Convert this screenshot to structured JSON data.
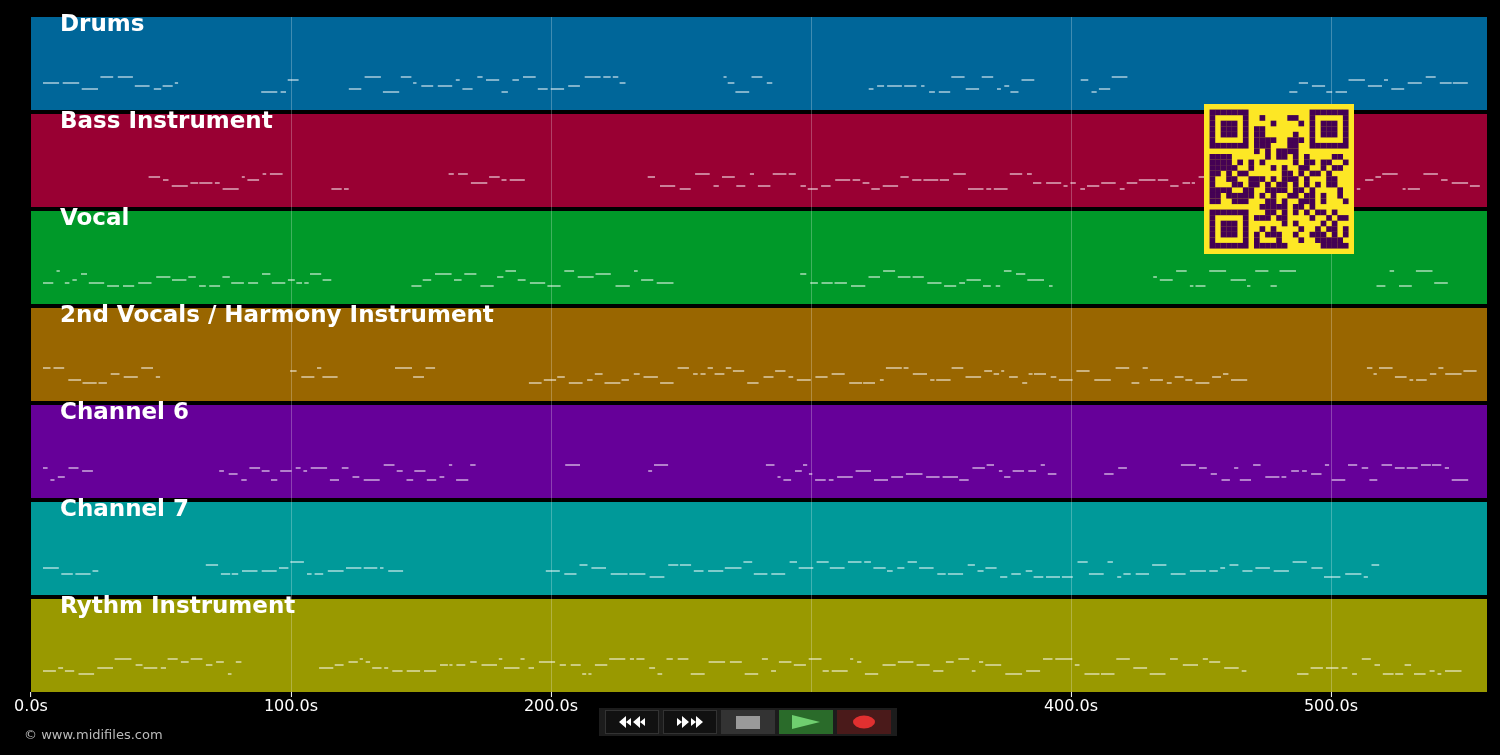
{
  "tracks": [
    {
      "name": "Drums",
      "color": "#006699"
    },
    {
      "name": "Bass Instrument",
      "color": "#990033"
    },
    {
      "name": "Vocal",
      "color": "#009929"
    },
    {
      "name": "2nd Vocals / Harmony Instrument",
      "color": "#996600"
    },
    {
      "name": "Channel 6",
      "color": "#660099"
    },
    {
      "name": "Channel 7",
      "color": "#009999"
    },
    {
      "name": "Rythm Instrument",
      "color": "#999900"
    }
  ],
  "time_axis": {
    "ticks": [
      "0.0s",
      "100.0s",
      "200.0s",
      "400.0s",
      "500.0s"
    ]
  },
  "transport": [
    {
      "kind": "rewind"
    },
    {
      "kind": "forward"
    },
    {
      "kind": "stop"
    },
    {
      "kind": "play"
    },
    {
      "kind": "record"
    }
  ],
  "footer": {
    "copyright": "© www.midifiles.com"
  }
}
